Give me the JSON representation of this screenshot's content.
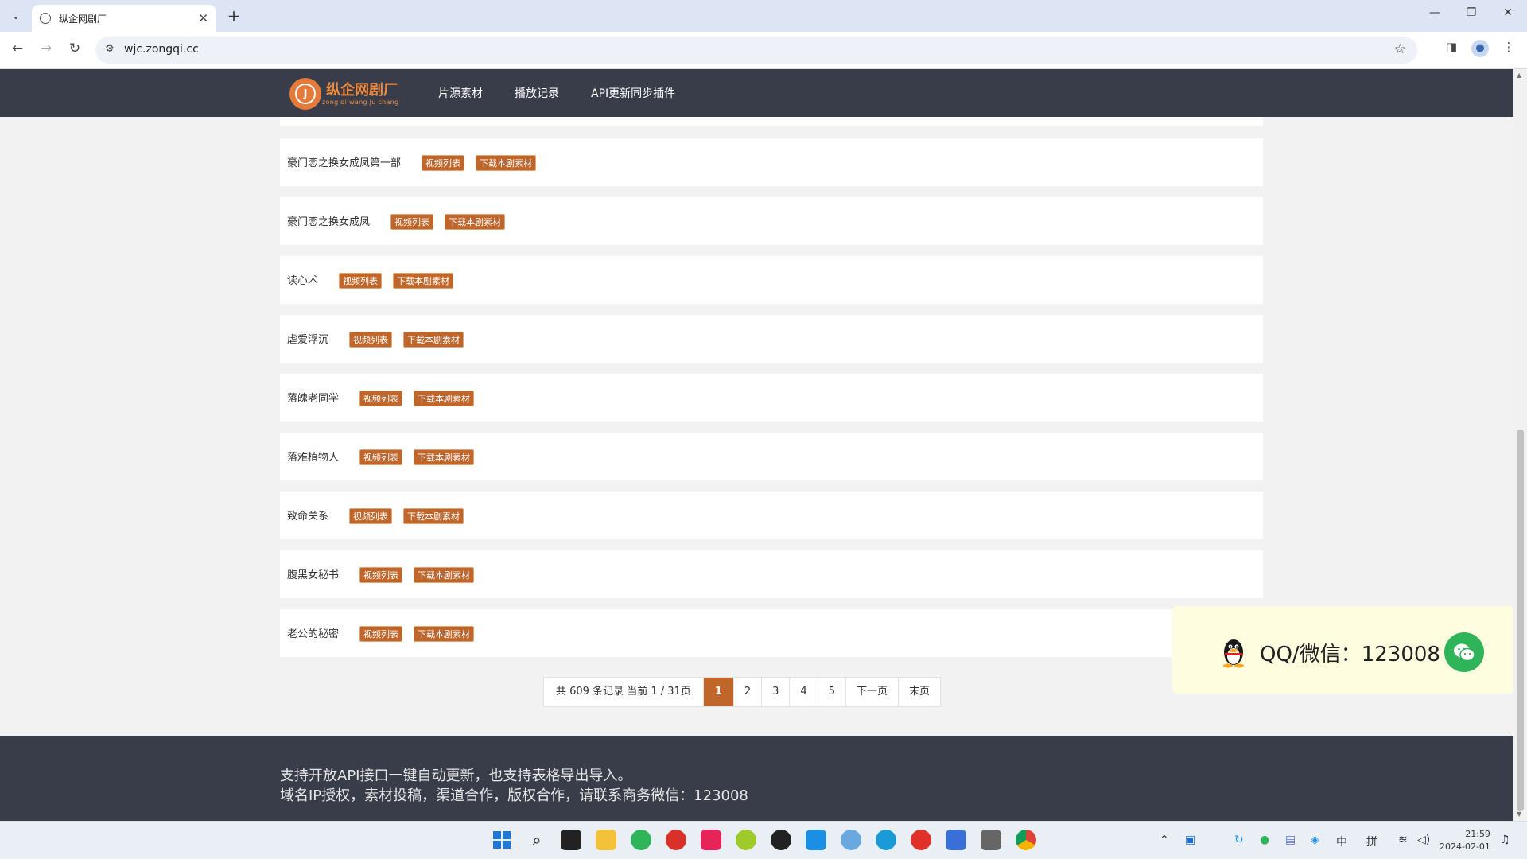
{
  "browser": {
    "tab_title": "纵企网剧厂",
    "url": "wjc.zongqi.cc",
    "close_tab_glyph": "✕",
    "new_tab_glyph": "+"
  },
  "site": {
    "logo_title": "纵企网剧厂",
    "logo_subtitle": "zong qi wang ju chang",
    "nav": [
      "片源素材",
      "播放记录",
      "API更新同步插件"
    ]
  },
  "list": [
    {
      "title": "豪门恋之换女成凤第一部",
      "btn_list": "视频列表",
      "btn_download": "下载本剧素材"
    },
    {
      "title": "豪门恋之换女成凤",
      "btn_list": "视频列表",
      "btn_download": "下载本剧素材"
    },
    {
      "title": "读心术",
      "btn_list": "视频列表",
      "btn_download": "下载本剧素材"
    },
    {
      "title": "虐爱浮沉",
      "btn_list": "视频列表",
      "btn_download": "下载本剧素材"
    },
    {
      "title": "落魄老同学",
      "btn_list": "视频列表",
      "btn_download": "下载本剧素材"
    },
    {
      "title": "落难植物人",
      "btn_list": "视频列表",
      "btn_download": "下载本剧素材"
    },
    {
      "title": "致命关系",
      "btn_list": "视频列表",
      "btn_download": "下载本剧素材"
    },
    {
      "title": "腹黑女秘书",
      "btn_list": "视频列表",
      "btn_download": "下载本剧素材"
    },
    {
      "title": "老公的秘密",
      "btn_list": "视频列表",
      "btn_download": "下载本剧素材"
    }
  ],
  "pagination": {
    "info": "共 609 条记录 当前 1 / 31页",
    "pages": [
      "1",
      "2",
      "3",
      "4",
      "5"
    ],
    "current": 1,
    "next": "下一页",
    "last": "末页"
  },
  "contact": {
    "text": "QQ/微信：123008"
  },
  "footer": {
    "line1": "支持开放API接口一键自动更新，也支持表格导出导入。",
    "line2": "域名IP授权，素材投稿，渠道合作，版权合作，请联系商务微信：123008"
  },
  "taskbar": {
    "tray_input_1": "中",
    "tray_input_2": "拼",
    "time": "21:59",
    "date": "2024-02-01"
  },
  "colors": {
    "accent": "#c0662a",
    "header_bg": "#393d49",
    "contact_bg": "#fffde0",
    "wechat_green": "#2fb45a"
  }
}
